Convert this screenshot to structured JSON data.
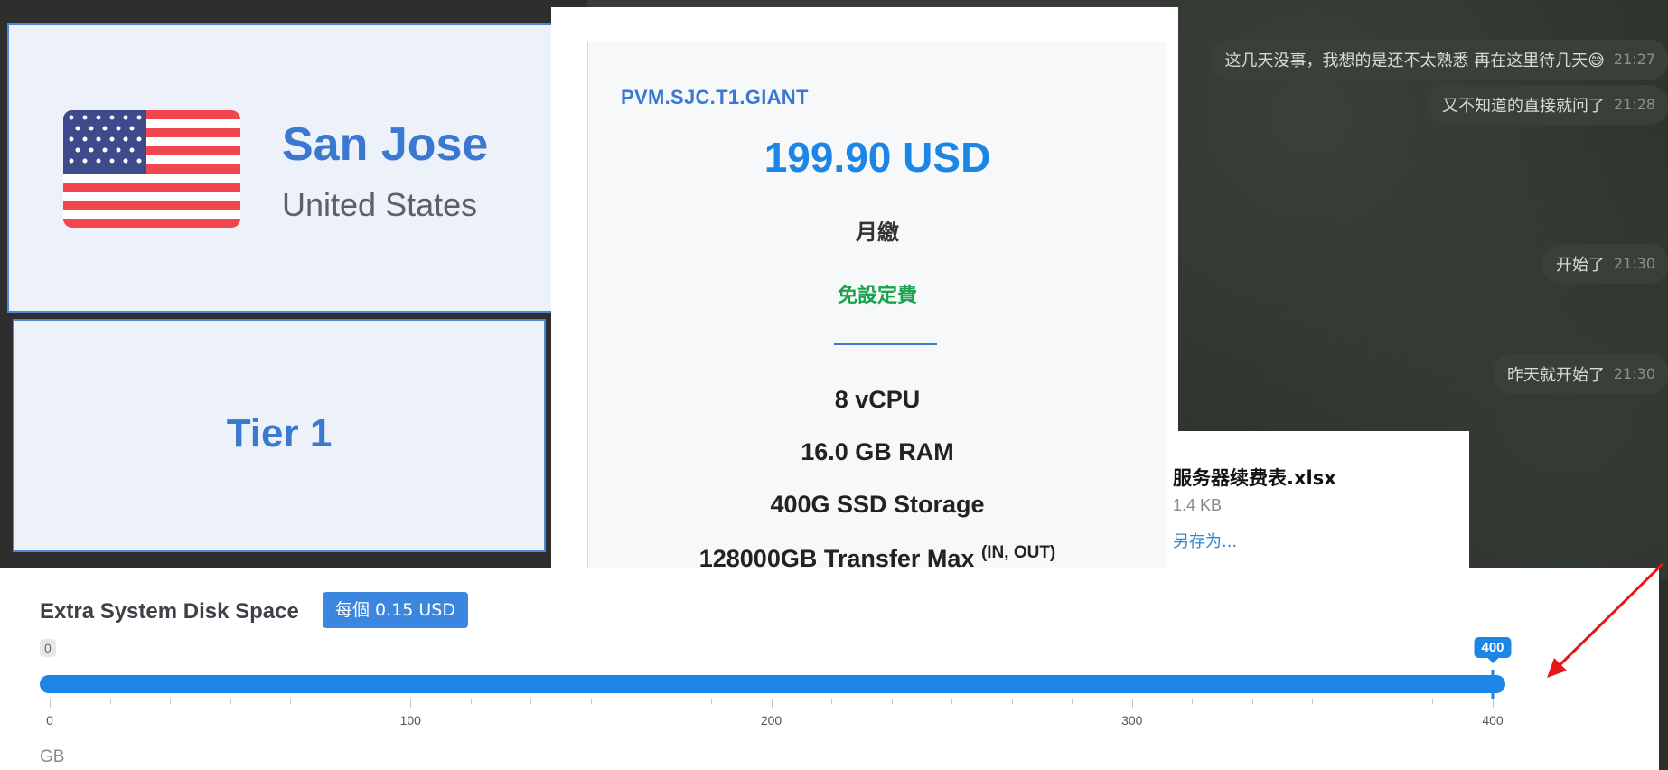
{
  "chat": {
    "top_message_partial": "这几天没事，我想的是还不太熟悉 再在这里待几天😅",
    "top_time": "21:27",
    "messages": [
      {
        "text": "又不知道的直接就问了",
        "time": "21:28"
      },
      {
        "text": "开始了",
        "time": "21:30"
      },
      {
        "text": "昨天就开始了",
        "time": "21:30"
      }
    ]
  },
  "location": {
    "flag_icon": "us-flag-icon",
    "city": "San Jose",
    "country": "United States",
    "tier": "Tier 1"
  },
  "plan": {
    "code": "PVM.SJC.T1.GIANT",
    "price": "199.90 USD",
    "billing_cycle": "月繳",
    "setup_fee": "免設定費",
    "specs": [
      "8 vCPU",
      "16.0 GB RAM",
      "400G SSD Storage"
    ],
    "transfer": "128000GB Transfer Max",
    "transfer_note": "(IN, OUT)"
  },
  "file": {
    "name_partial": "服务器续费表.xlsx",
    "size_partial": "1.4 KB",
    "save_partial": "另存为..."
  },
  "disk": {
    "title": "Extra System Disk Space",
    "price_per_unit": "每個 0.15 USD",
    "min_label": "0",
    "current_value": 400,
    "current_label": "400",
    "min": 0,
    "max": 400,
    "tick_labels": [
      "0",
      "100",
      "200",
      "300",
      "400"
    ],
    "unit": "GB"
  },
  "colors": {
    "accent": "#1b86e6",
    "brand_blue": "#3b78cf",
    "setup_green": "#1aa34a",
    "annotation_arrow": "#e8161a"
  }
}
